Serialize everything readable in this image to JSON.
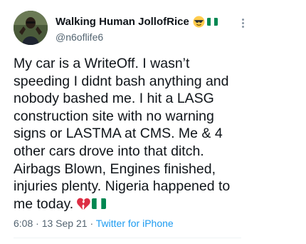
{
  "user": {
    "display_name": "Walking Human JollofRice",
    "handle": "@n6oflife6",
    "name_emojis": [
      "sunglasses-face-emoji",
      "nigeria-flag-emoji"
    ]
  },
  "tweet": {
    "lines": [
      "My car is a WriteOff. I wasn’t",
      "speeding I didnt bash anything and",
      "nobody bashed me. I hit a LASG",
      "construction site with no warning",
      "signs or LASTMA at CMS. Me & 4",
      "other cars drove into that ditch.",
      "Airbags Blown, Engines finished,",
      "injuries plenty. Nigeria happened to",
      "me today."
    ],
    "trailing_emojis": [
      "broken-heart-emoji",
      "nigeria-flag-emoji"
    ]
  },
  "meta": {
    "time": "6:08",
    "separator": "·",
    "date": "13 Sep 21",
    "source": "Twitter for iPhone"
  },
  "colors": {
    "text": "#0f1419",
    "secondary": "#536471",
    "link": "#1d9bf0",
    "flag_green": "#008751"
  }
}
